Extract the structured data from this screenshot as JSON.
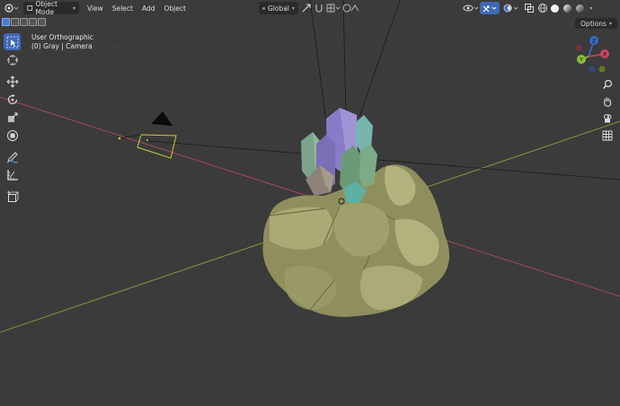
{
  "header": {
    "mode": "Object Mode",
    "menus": [
      "View",
      "Select",
      "Add",
      "Object"
    ],
    "orientation": "Global"
  },
  "overlay": {
    "view_name": "User Orthographic",
    "collection_info": "(0) Gray | Camera"
  },
  "options_label": "Options",
  "gizmo_axes": {
    "x": "X",
    "y": "Y",
    "z": "Z"
  },
  "colors": {
    "viewport_bg": "#3b3b3b",
    "x_axis": "#b5485a",
    "y_axis": "#86a03a",
    "active_tool": "#3f68b5",
    "camera_outline": "#c8c83a"
  }
}
